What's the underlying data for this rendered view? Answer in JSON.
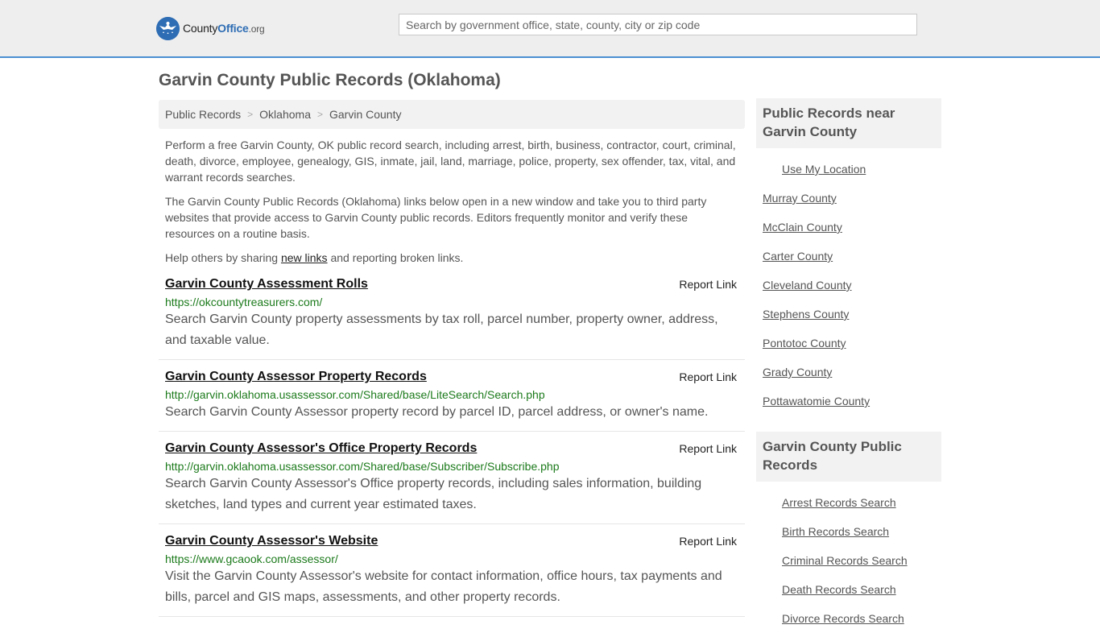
{
  "header": {
    "logo": {
      "part1": "County",
      "part2": "Office",
      "part3": ".org"
    },
    "search_placeholder": "Search by government office, state, county, city or zip code"
  },
  "page_title": "Garvin County Public Records (Oklahoma)",
  "breadcrumb": [
    {
      "label": "Public Records"
    },
    {
      "label": "Oklahoma"
    },
    {
      "label": "Garvin County"
    }
  ],
  "breadcrumb_sep": ">",
  "intro": {
    "p1": "Perform a free Garvin County, OK public record search, including arrest, birth, business, contractor, court, criminal, death, divorce, employee, genealogy, GIS, inmate, jail, land, marriage, police, property, sex offender, tax, vital, and warrant records searches.",
    "p2": "The Garvin County Public Records (Oklahoma) links below open in a new window and take you to third party websites that provide access to Garvin County public records. Editors frequently monitor and verify these resources on a routine basis.",
    "p3_before": "Help others by sharing ",
    "p3_link": "new links",
    "p3_after": " and reporting broken links."
  },
  "records": [
    {
      "title": "Garvin County Assessment Rolls",
      "report": "Report Link",
      "url": "https://okcountytreasurers.com/",
      "desc": "Search Garvin County property assessments by tax roll, parcel number, property owner, address, and taxable value."
    },
    {
      "title": "Garvin County Assessor Property Records",
      "report": "Report Link",
      "url": "http://garvin.oklahoma.usassessor.com/Shared/base/LiteSearch/Search.php",
      "desc": "Search Garvin County Assessor property record by parcel ID, parcel address, or owner's name."
    },
    {
      "title": "Garvin County Assessor's Office Property Records",
      "report": "Report Link",
      "url": "http://garvin.oklahoma.usassessor.com/Shared/base/Subscriber/Subscribe.php",
      "desc": "Search Garvin County Assessor's Office property records, including sales information, building sketches, land types and current year estimated taxes."
    },
    {
      "title": "Garvin County Assessor's Website",
      "report": "Report Link",
      "url": "https://www.gcaook.com/assessor/",
      "desc": "Visit the Garvin County Assessor's website for contact information, office hours, tax payments and bills, parcel and GIS maps, assessments, and other property records."
    }
  ],
  "sidebar": {
    "nearby_title": "Public Records near Garvin County",
    "use_location": "Use My Location",
    "nearby": [
      "Murray County",
      "McClain County",
      "Carter County",
      "Cleveland County",
      "Stephens County",
      "Pontotoc County",
      "Grady County",
      "Pottawatomie County"
    ],
    "records_title": "Garvin County Public Records",
    "record_links": [
      "Arrest Records Search",
      "Birth Records Search",
      "Criminal Records Search",
      "Death Records Search",
      "Divorce Records Search"
    ]
  },
  "colors": {
    "accent": "#4b8fd1",
    "link_green": "#1c7a1c",
    "logo_blue": "#2e6db4"
  }
}
